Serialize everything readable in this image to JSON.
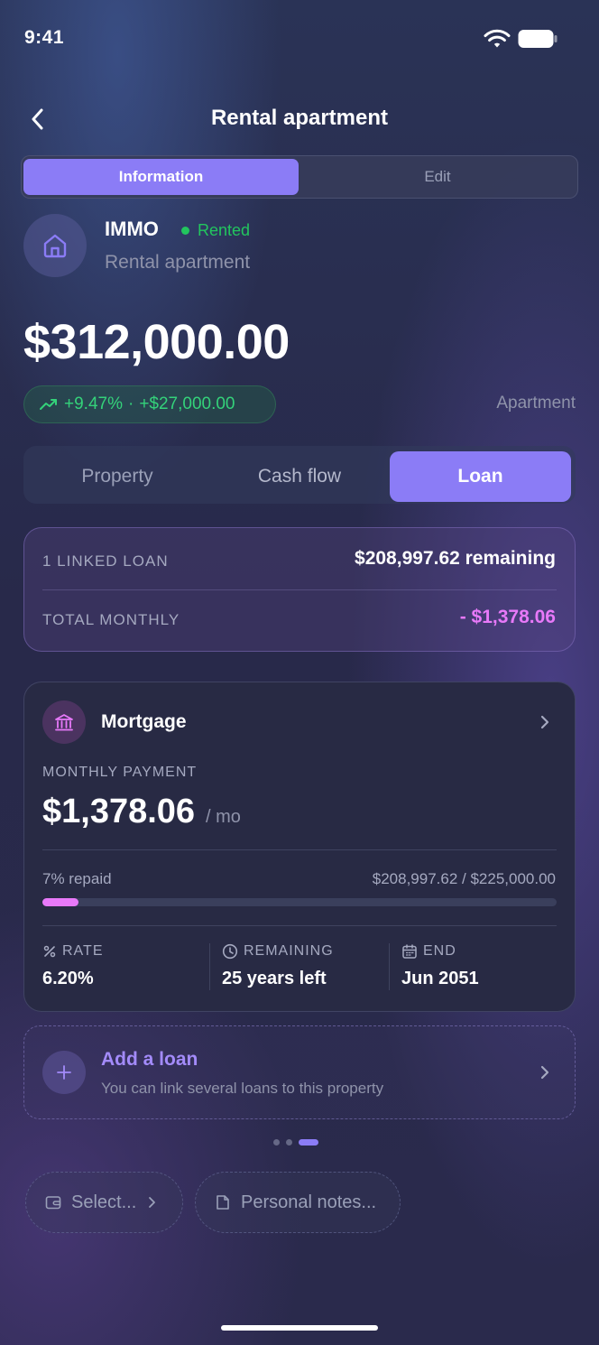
{
  "status_bar": {
    "time": "9:41"
  },
  "header": {
    "title": "Rental apartment"
  },
  "segmented": {
    "information": "Information",
    "edit": "Edit"
  },
  "property": {
    "name": "IMMO",
    "status": "Rented",
    "subtitle": "Rental apartment",
    "value": "$312,000.00",
    "change_percent": "+9.47%",
    "change_separator": "·",
    "change_amount": "+$27,000.00",
    "type": "Apartment"
  },
  "tabs": {
    "property": "Property",
    "cashflow": "Cash flow",
    "loan": "Loan",
    "active": "Loan"
  },
  "summary": {
    "linked_label": "1 LINKED LOAN",
    "linked_value": "$208,997.62 remaining",
    "monthly_label": "TOTAL MONTHLY",
    "monthly_value": "- $1,378.06"
  },
  "loan": {
    "name": "Mortgage",
    "monthly_label": "MONTHLY PAYMENT",
    "monthly_value": "$1,378.06",
    "monthly_unit": "/ mo",
    "repaid_label": "7% repaid",
    "repaid_fraction": 0.07,
    "repaid_amount": "$208,997.62 / $225,000.00",
    "rate_label": "RATE",
    "rate_value": "6.20%",
    "remaining_label": "REMAINING",
    "remaining_value": "25 years left",
    "end_label": "END",
    "end_value": "Jun 2051"
  },
  "add_loan": {
    "title": "Add a loan",
    "subtitle": "You can link several loans to this property",
    "icon": "plus-icon"
  },
  "pager": {
    "count": 3,
    "active_index": 2
  },
  "chips": {
    "select": "Select...",
    "notes": "Personal notes..."
  },
  "colors": {
    "accent": "#8b7cf6",
    "positive": "#22c55e",
    "negative": "#e879f9"
  }
}
